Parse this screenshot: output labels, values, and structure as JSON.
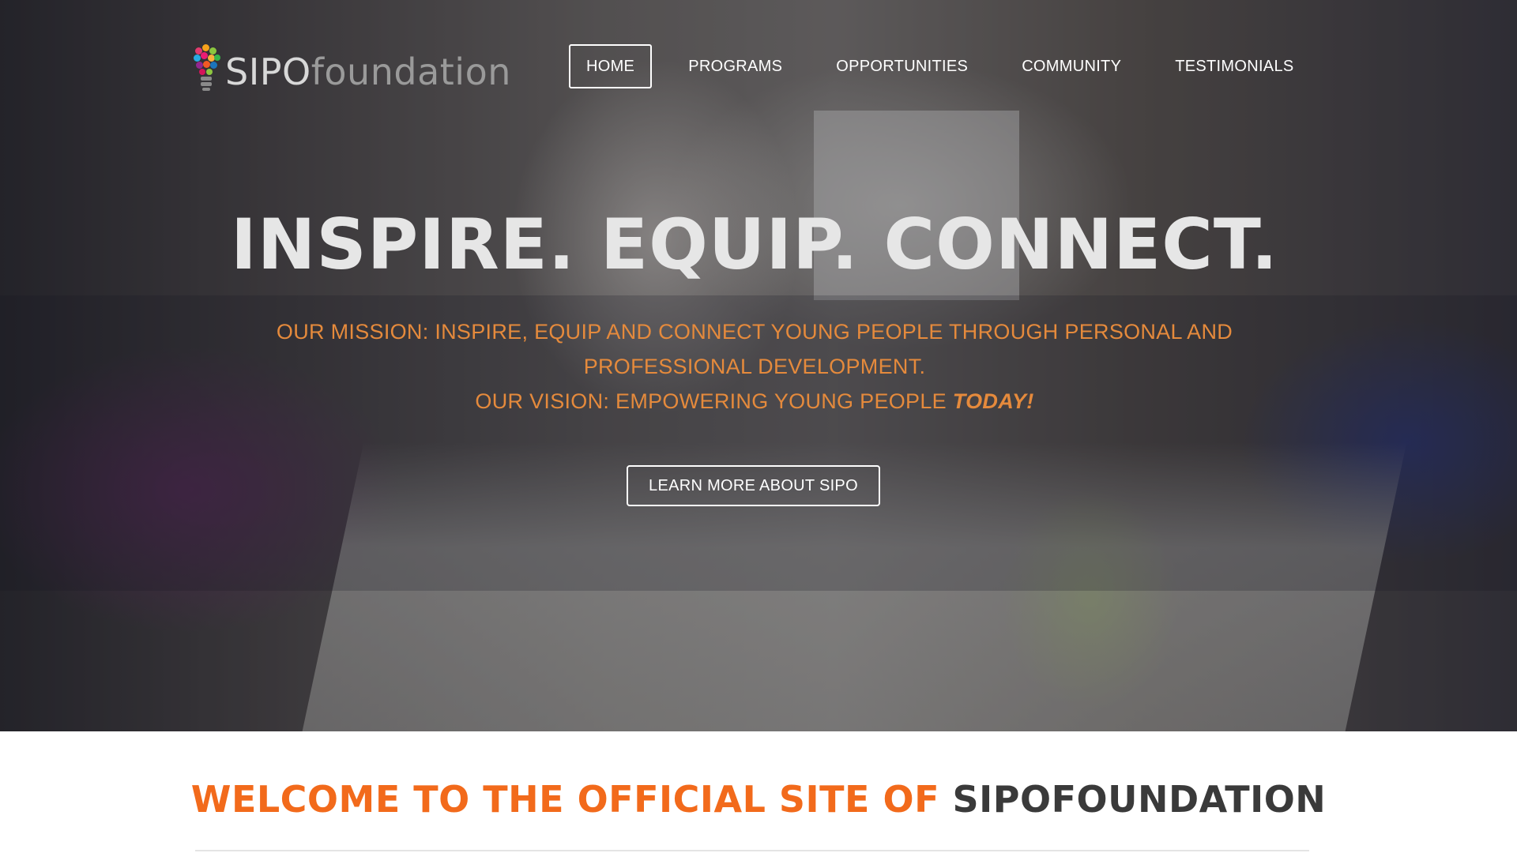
{
  "logo": {
    "text_main": "SIPO",
    "text_rest": "foundation"
  },
  "nav": {
    "items": [
      {
        "label": "HOME",
        "active": true
      },
      {
        "label": "PROGRAMS",
        "active": false
      },
      {
        "label": "OPPORTUNITIES",
        "active": false
      },
      {
        "label": "COMMUNITY",
        "active": false
      },
      {
        "label": "TESTIMONIALS",
        "active": false
      }
    ]
  },
  "hero": {
    "title": "INSPIRE. EQUIP. CONNECT.",
    "mission_line": "OUR MISSION:  INSPIRE, EQUIP AND CONNECT YOUNG PEOPLE THROUGH PERSONAL AND PROFESSIONAL DEVELOPMENT.",
    "vision_prefix": "OUR VISION:  EMPOWERING YOUNG PEOPLE ",
    "vision_emphasis": "TODAY!",
    "button_label": "LEARN MORE ABOUT SIPO"
  },
  "welcome": {
    "part_orange": "WELCOME TO THE OFFICIAL SITE OF ",
    "part_dark": "SIPOFOUNDATION"
  },
  "colors": {
    "accent_orange": "#f26a1b",
    "mission_orange": "#e58a3c",
    "heading_dark": "#3a3a3a"
  }
}
